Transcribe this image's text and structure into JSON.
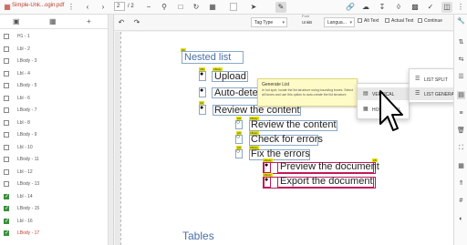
{
  "file": {
    "name": "Simple-Unk...ogin.pdf"
  },
  "pager": {
    "current": "2",
    "total": "/ 2"
  },
  "toolbar2": {
    "tag_type_label": "Tag Type",
    "lang_label": "Langua...",
    "unk_top": "Font",
    "unk_value": "UnkB",
    "alt_text": "Alt Text",
    "actual_text": "Actual Text",
    "continue": "Continue"
  },
  "sidebar": {
    "rows": [
      {
        "label": "H1 - 1",
        "checked": false,
        "red": false
      },
      {
        "label": "Lbl - 2",
        "checked": false,
        "red": false
      },
      {
        "label": "LBody - 3",
        "checked": false,
        "red": false
      },
      {
        "label": "Lbl - 4",
        "checked": false,
        "red": false
      },
      {
        "label": "LBody - 5",
        "checked": false,
        "red": false
      },
      {
        "label": "Lbl - 6",
        "checked": false,
        "red": false
      },
      {
        "label": "LBody - 7",
        "checked": false,
        "red": false
      },
      {
        "label": "Lbl - 8",
        "checked": false,
        "red": false
      },
      {
        "label": "LBody - 9",
        "checked": false,
        "red": false
      },
      {
        "label": "Lbl - 10",
        "checked": false,
        "red": false
      },
      {
        "label": "LBody - 11",
        "checked": false,
        "red": false
      },
      {
        "label": "Lbl - 12",
        "checked": false,
        "red": false
      },
      {
        "label": "LBody - 13",
        "checked": false,
        "red": false
      },
      {
        "label": "Lbl - 14",
        "checked": true,
        "red": false
      },
      {
        "label": "LBody - 15",
        "checked": true,
        "red": false
      },
      {
        "label": "Lbl - 16",
        "checked": true,
        "red": false
      },
      {
        "label": "LBody - 17",
        "checked": true,
        "red": true
      }
    ]
  },
  "document": {
    "heading": "Nested list",
    "items": {
      "upload": "Upload",
      "auto": "Auto-dete",
      "review": "Review the content",
      "review2": "Review the content",
      "check": "Check for errors",
      "fix": "Fix the errors",
      "preview": "Preview the document",
      "export": "Export the document"
    },
    "tables_heading": "Tables"
  },
  "tooltip": {
    "title": "Generate List",
    "body": "In hot spot, locate the list structure using bounding boxes. Select all boxes and use this option to auto-create the list structure."
  },
  "context_menu": {
    "main": [
      {
        "label": "LIST SPLIT"
      },
      {
        "label": "LIST GENERATION"
      }
    ],
    "sub": [
      {
        "label": "VERTICAL"
      },
      {
        "label": "HORIZONTAL"
      }
    ]
  },
  "colors": {
    "accent_red": "#c0392b",
    "tag_yellow": "#e6e200",
    "box_blue": "#8aa8c8",
    "box_pink": "#c2185b",
    "heading_blue": "#4a6fa5"
  }
}
